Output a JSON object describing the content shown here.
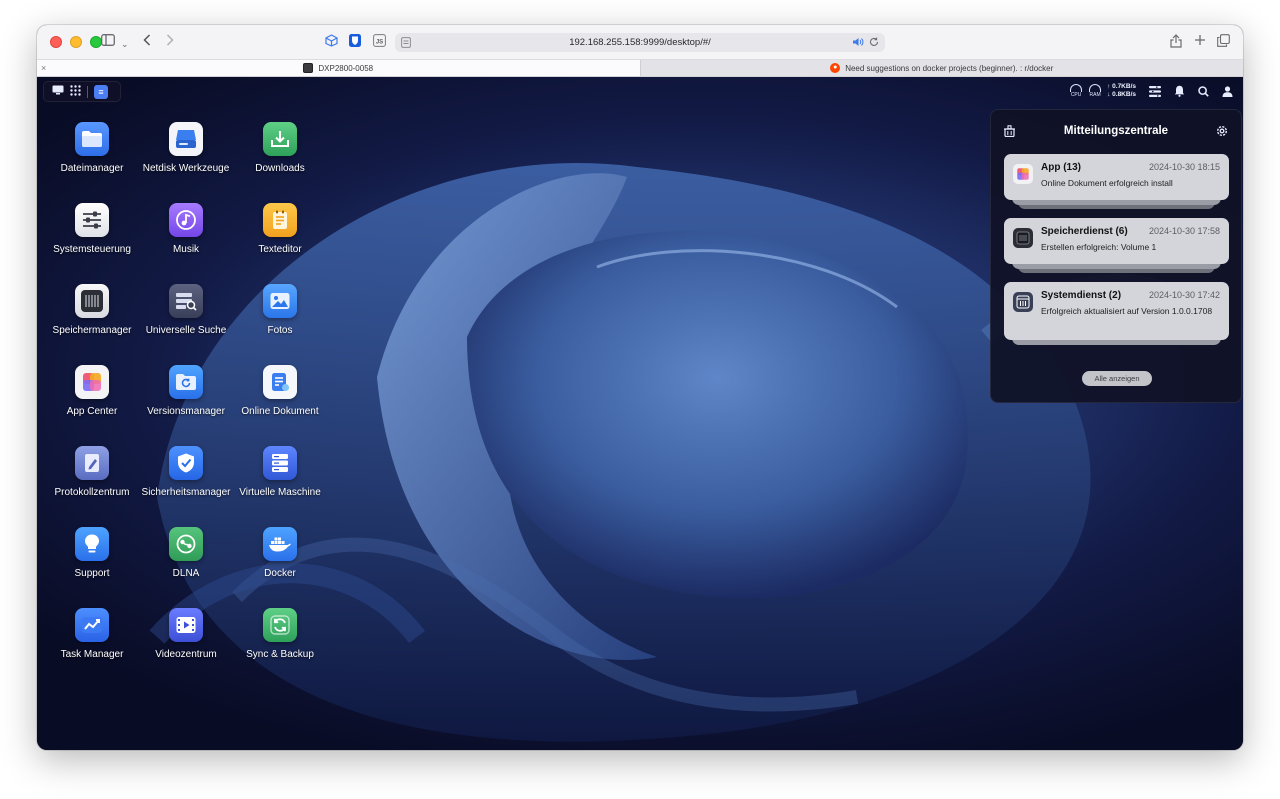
{
  "browser": {
    "url": "192.168.255.158:9999/desktop/#/",
    "tabs": [
      {
        "title": "DXP2800-0058",
        "active": true
      },
      {
        "title": "Need suggestions on docker projects (beginner). : r/docker",
        "active": false
      }
    ],
    "close_glyph": "×"
  },
  "status": {
    "cpu_label": "CPU",
    "ram_label": "RAM",
    "upload": "↑ 0.7KB/s",
    "download": "↓ 0.8KB/s"
  },
  "apps": [
    {
      "id": "dateimanager",
      "label": "Dateimanager",
      "icon": "folder-icon",
      "color": "#3f7df1"
    },
    {
      "id": "netdisk",
      "label": "Netdisk Werkzeuge",
      "icon": "netdisk-icon",
      "color": "#2f7cf0"
    },
    {
      "id": "downloads",
      "label": "Downloads",
      "icon": "download-icon",
      "color": "#36b36a"
    },
    {
      "id": "systemsteuerung",
      "label": "Systemsteuerung",
      "icon": "sliders-icon",
      "color": "#e9ebee"
    },
    {
      "id": "musik",
      "label": "Musik",
      "icon": "music-icon",
      "color": "#8b5cf6"
    },
    {
      "id": "texteditor",
      "label": "Texteditor",
      "icon": "notepad-icon",
      "color": "#f5b331"
    },
    {
      "id": "speichermanager",
      "label": "Speichermanager",
      "icon": "storage-icon",
      "color": "#e4e6ea"
    },
    {
      "id": "universelle-suche",
      "label": "Universelle Suche",
      "icon": "search-server-icon",
      "color": "#4b5068"
    },
    {
      "id": "fotos",
      "label": "Fotos",
      "icon": "photo-icon",
      "color": "#3b8bf0"
    },
    {
      "id": "app-center",
      "label": "App Center",
      "icon": "app-center-icon",
      "color": "#f2f2f4"
    },
    {
      "id": "versionsmanager",
      "label": "Versionsmanager",
      "icon": "version-icon",
      "color": "#2f86f2"
    },
    {
      "id": "online-dokument",
      "label": "Online Dokument",
      "icon": "document-icon",
      "color": "#f2f4f8"
    },
    {
      "id": "protokollzentrum",
      "label": "Protokollzentrum",
      "icon": "log-icon",
      "color": "#6b7cc8"
    },
    {
      "id": "sicherheitsmanager",
      "label": "Sicherheitsmanager",
      "icon": "shield-icon",
      "color": "#2f7cf0"
    },
    {
      "id": "virtuelle-maschine",
      "label": "Virtuelle Maschine",
      "icon": "vm-icon",
      "color": "#3f6ee8"
    },
    {
      "id": "support",
      "label": "Support",
      "icon": "bulb-icon",
      "color": "#2f86f2"
    },
    {
      "id": "dlna",
      "label": "DLNA",
      "icon": "dlna-icon",
      "color": "#3daa64"
    },
    {
      "id": "docker",
      "label": "Docker",
      "icon": "docker-icon",
      "color": "#2f86f2"
    },
    {
      "id": "task-manager",
      "label": "Task Manager",
      "icon": "chart-icon",
      "color": "#2f7cf0"
    },
    {
      "id": "videozentrum",
      "label": "Videozentrum",
      "icon": "video-icon",
      "color": "#4b63e8"
    },
    {
      "id": "sync-backup",
      "label": "Sync & Backup",
      "icon": "sync-icon",
      "color": "#37b56c"
    }
  ],
  "notifications": {
    "title": "Mitteilungszentrale",
    "show_all": "Alle anzeigen",
    "items": [
      {
        "title": "App (13)",
        "time": "2024-10-30 18:15",
        "message": "Online Dokument erfolgreich install",
        "icon": "app-center-icon"
      },
      {
        "title": "Speicherdienst (6)",
        "time": "2024-10-30 17:58",
        "message": "Erstellen erfolgreich: Volume 1",
        "icon": "storage-icon"
      },
      {
        "title": "Systemdienst (2)",
        "time": "2024-10-30 17:42",
        "message": "Erfolgreich aktualisiert auf Version 1.0.0.1708",
        "icon": "system-icon"
      }
    ]
  }
}
